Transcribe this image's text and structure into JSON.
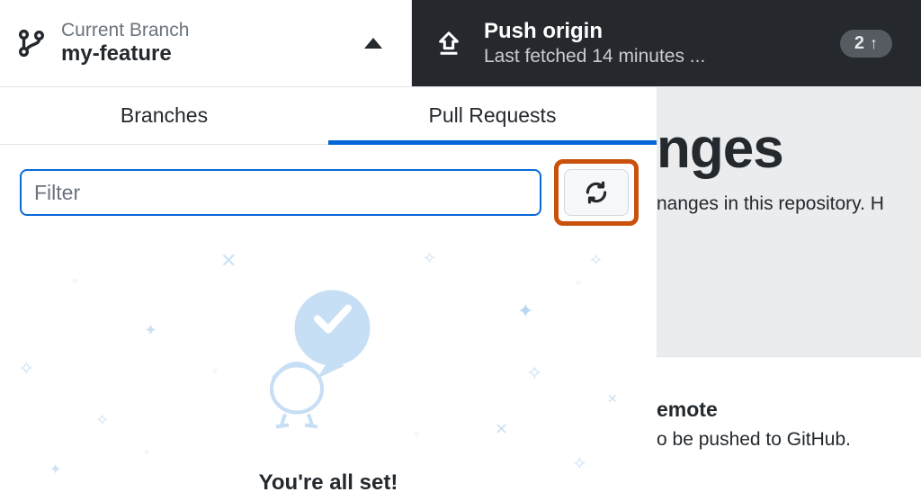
{
  "toolbar": {
    "branch": {
      "label": "Current Branch",
      "name": "my-feature"
    },
    "push": {
      "title": "Push origin",
      "subtitle": "Last fetched 14 minutes ...",
      "badge_count": "2"
    }
  },
  "tabs": {
    "branches": "Branches",
    "pull_requests": "Pull Requests"
  },
  "filter": {
    "placeholder": "Filter"
  },
  "empty": {
    "title": "You're all set!"
  },
  "right": {
    "heading": "nges",
    "desc": "nanges in this repository. H",
    "sub_heading": "emote",
    "sub_desc": "o be pushed to GitHub."
  }
}
